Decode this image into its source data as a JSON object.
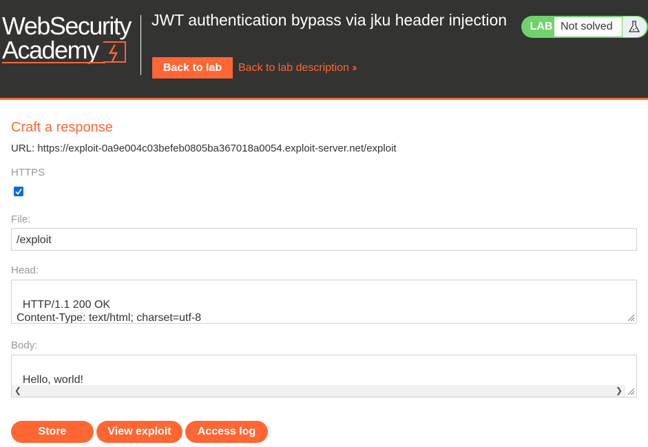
{
  "header": {
    "logo_line1": "WebSecurity",
    "logo_line2": "Academy",
    "lab_title": "JWT authentication bypass via jku header injection",
    "back_to_lab": "Back to lab",
    "back_to_description": "Back to lab description",
    "status_badge": "LAB",
    "status_text": "Not solved"
  },
  "form": {
    "section_title": "Craft a response",
    "url_label": "URL: https://exploit-0a9e004c03befeb0805ba367018a0054.exploit-server.net/exploit",
    "https_label": "HTTPS",
    "https_checked": true,
    "file_label": "File:",
    "file_value": "/exploit",
    "head_label": "Head:",
    "head_value": "HTTP/1.1 200 OK\nContent-Type: text/html; charset=utf-8",
    "body_label": "Body:",
    "body_value": "Hello, world!"
  },
  "buttons": {
    "store": "Store",
    "view_exploit": "View exploit",
    "access_log": "Access log"
  },
  "colors": {
    "accent": "#ff6633",
    "header_bg": "#333332",
    "status_green": "#70d16d",
    "checkbox_blue": "#0b6cd9"
  }
}
